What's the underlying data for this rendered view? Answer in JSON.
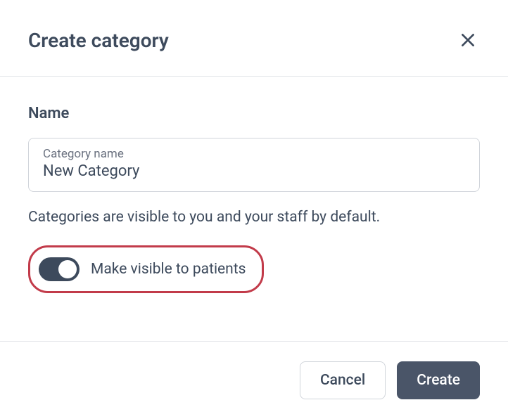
{
  "header": {
    "title": "Create category"
  },
  "form": {
    "name_label": "Name",
    "name_floating_label": "Category name",
    "name_value": "New Category",
    "helper_text": "Categories are visible to you and your staff by default.",
    "toggle_label": "Make visible to patients",
    "toggle_on": true
  },
  "footer": {
    "cancel_label": "Cancel",
    "create_label": "Create"
  }
}
